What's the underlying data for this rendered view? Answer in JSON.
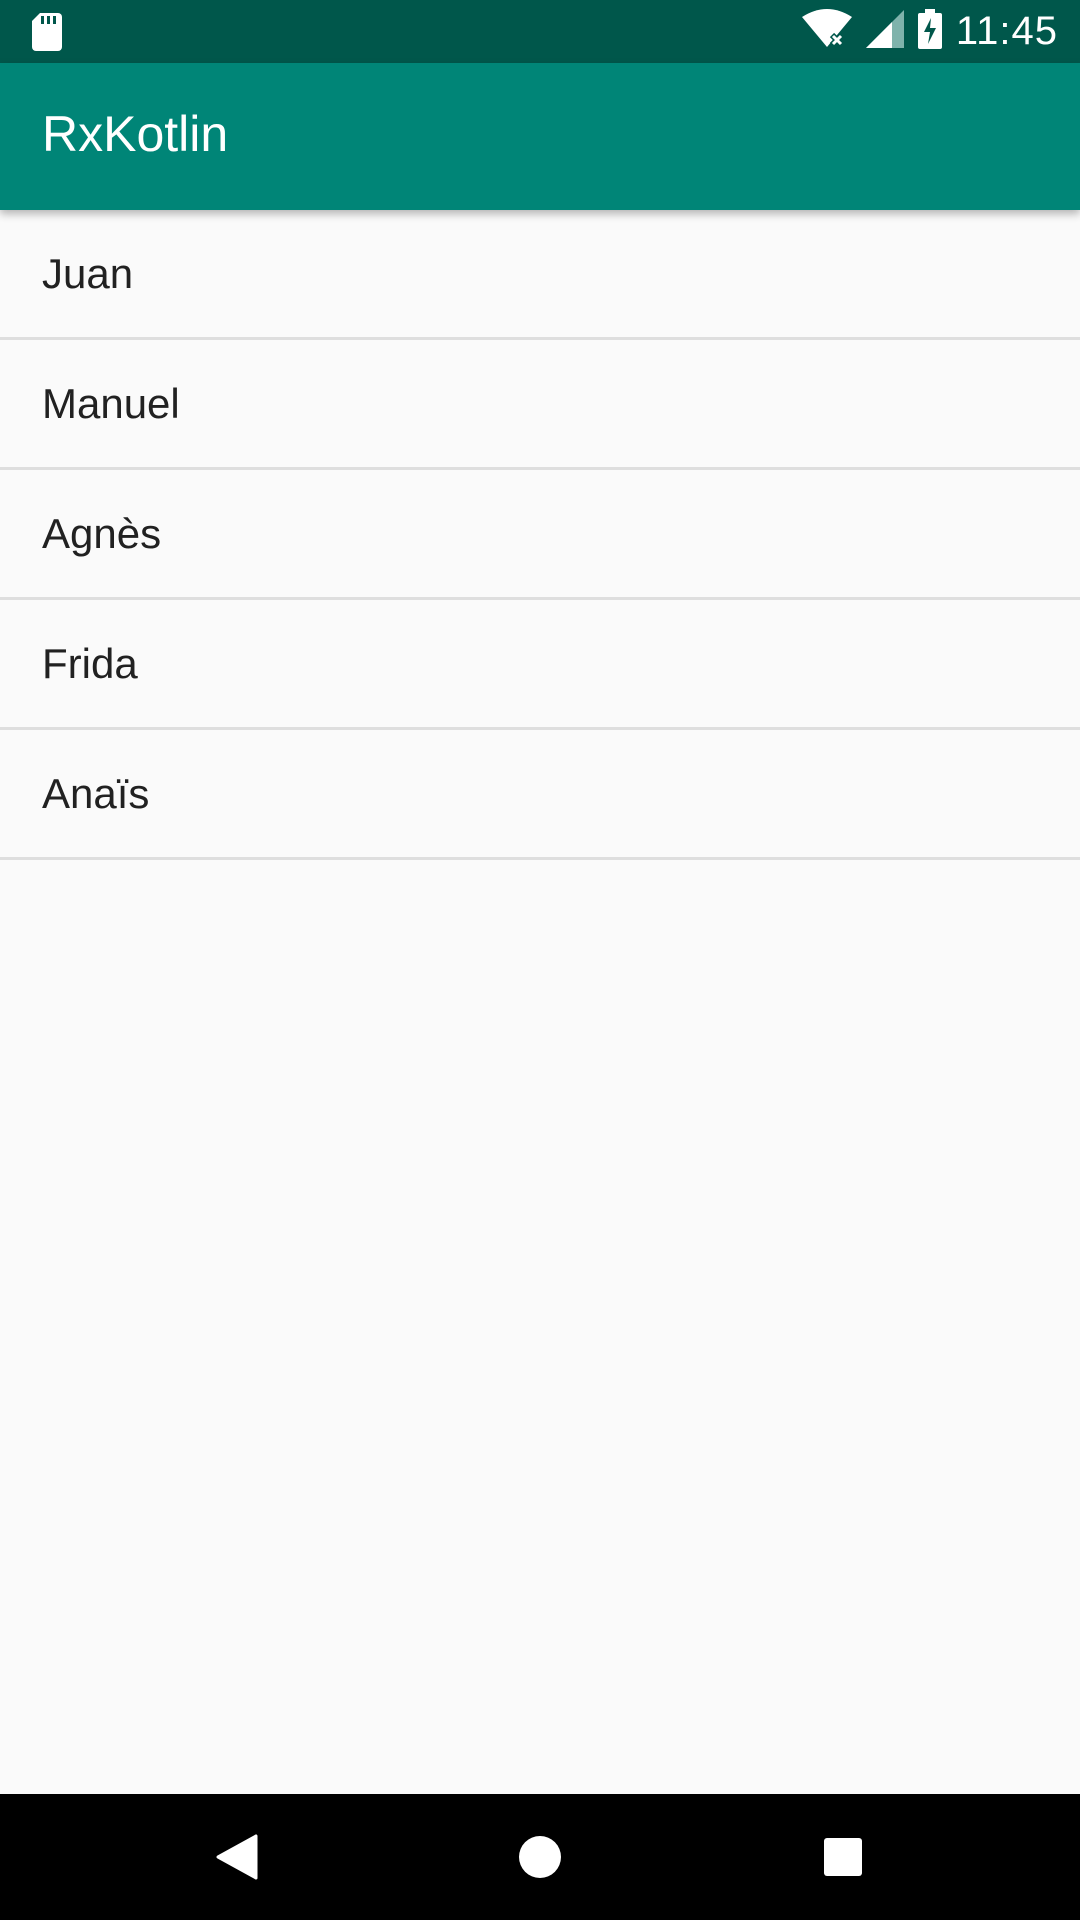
{
  "status_bar": {
    "time": "11:45",
    "icons": [
      "sd-card-icon",
      "wifi-no-internet-icon",
      "cell-signal-icon",
      "battery-charging-icon"
    ]
  },
  "app_bar": {
    "title": "RxKotlin",
    "color": "#008577",
    "status_color": "#00574b"
  },
  "list": {
    "items": [
      "Juan",
      "Manuel",
      "Agnès",
      "Frida",
      "Anaïs"
    ]
  },
  "nav_bar": {
    "buttons": [
      "back-icon",
      "home-icon",
      "recents-icon"
    ]
  }
}
